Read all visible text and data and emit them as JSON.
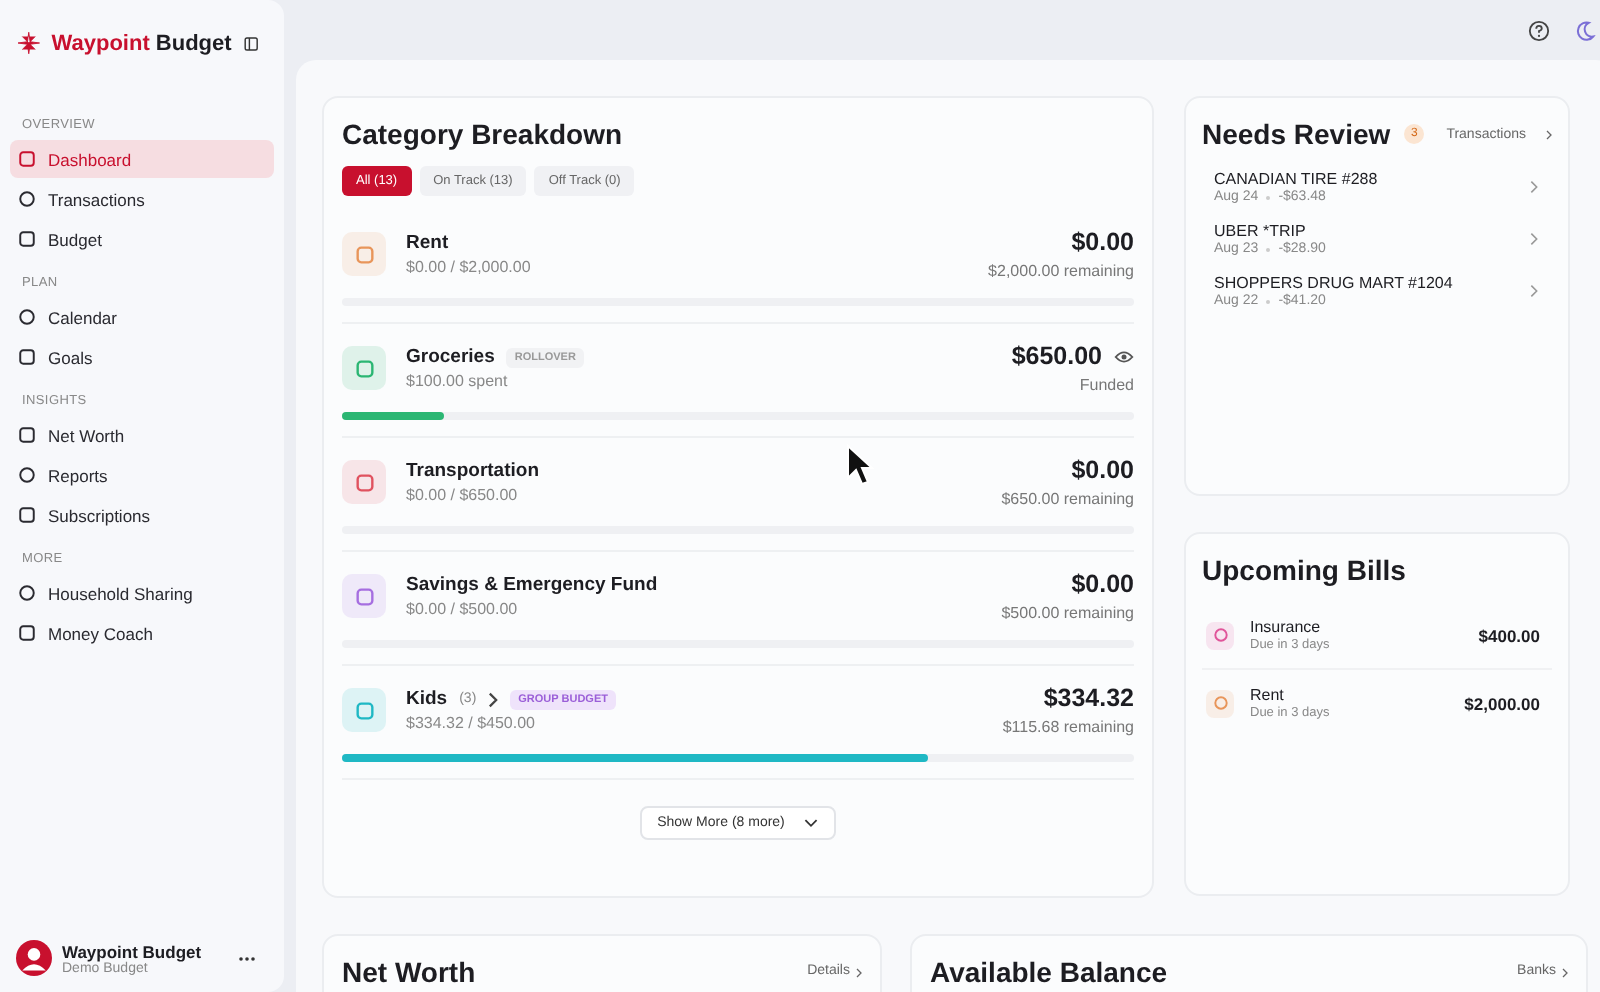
{
  "sidebar": {
    "brand": {
      "first": "Waypoint",
      "second": "Budget"
    },
    "sections": [
      {
        "heading": "OVERVIEW",
        "items": [
          {
            "label": "Dashboard",
            "selected": true
          },
          {
            "label": "Transactions",
            "selected": false
          },
          {
            "label": "Budget",
            "selected": false
          }
        ]
      },
      {
        "heading": "PLAN",
        "items": [
          {
            "label": "Calendar",
            "selected": false
          },
          {
            "label": "Goals",
            "selected": false
          }
        ]
      },
      {
        "heading": "INSIGHTS",
        "items": [
          {
            "label": "Net Worth",
            "selected": false
          },
          {
            "label": "Reports",
            "selected": false
          },
          {
            "label": "Subscriptions",
            "selected": false
          }
        ]
      },
      {
        "heading": "MORE",
        "items": [
          {
            "label": "Household Sharing",
            "selected": false
          },
          {
            "label": "Money Coach",
            "selected": false
          }
        ]
      }
    ],
    "user": {
      "name": "Waypoint Budget",
      "subtitle": "Demo Budget"
    }
  },
  "category_breakdown": {
    "title": "Category Breakdown",
    "filters": [
      {
        "label": "All (13)",
        "selected": true
      },
      {
        "label": "On Track (13)",
        "selected": false
      },
      {
        "label": "Off Track (0)",
        "selected": false
      }
    ],
    "categories": [
      {
        "name": "Rent",
        "detail": "$0.00 / $2,000.00",
        "amount": "$0.00",
        "status": "$2,000.00 remaining",
        "level": 0,
        "color": "#e8955a"
      },
      {
        "name": "Groceries",
        "badge": {
          "label": "ROLLOVER",
          "kind": "plain"
        },
        "detail": "$100.00 spent",
        "amount": "$650.00",
        "watch": true,
        "status": "Funded",
        "level": 0.13,
        "color": "#2bb673"
      },
      {
        "name": "Transportation",
        "detail": "$0.00 / $650.00",
        "amount": "$0.00",
        "status": "$650.00 remaining",
        "level": 0,
        "color": "#e0525f"
      },
      {
        "name": "Savings & Emergency Fund",
        "detail": "$0.00 / $500.00",
        "amount": "$0.00",
        "status": "$500.00 remaining",
        "level": 0,
        "color": "#a66ee0"
      },
      {
        "name": "Kids",
        "count": "(3)",
        "badge": {
          "label": "GROUP BUDGET",
          "kind": "group"
        },
        "detail": "$334.32 / $450.00",
        "amount": "$334.32",
        "status": "$115.68 remaining",
        "level": 0.74,
        "color": "#1fb8c4"
      }
    ],
    "show_more": "Show More (8 more)"
  },
  "needs_review": {
    "title": "Needs Review",
    "count": "3",
    "link": "Transactions",
    "items": [
      {
        "name": "CANADIAN TIRE #288",
        "date": "Aug 24",
        "amount": "-$63.48"
      },
      {
        "name": "UBER *TRIP",
        "date": "Aug 23",
        "amount": "-$28.90"
      },
      {
        "name": "SHOPPERS DRUG MART #1204",
        "date": "Aug 22",
        "amount": "-$41.20"
      }
    ]
  },
  "upcoming_bills": {
    "title": "Upcoming Bills",
    "items": [
      {
        "name": "Insurance",
        "due": "Due in 3 days",
        "amount": "$400.00",
        "color": "#e0559a"
      },
      {
        "name": "Rent",
        "due": "Due in 3 days",
        "amount": "$2,000.00",
        "color": "#e8955a"
      }
    ]
  },
  "net_worth": {
    "title": "Net Worth",
    "link": "Details"
  },
  "available_balance": {
    "title": "Available Balance",
    "link": "Banks"
  }
}
